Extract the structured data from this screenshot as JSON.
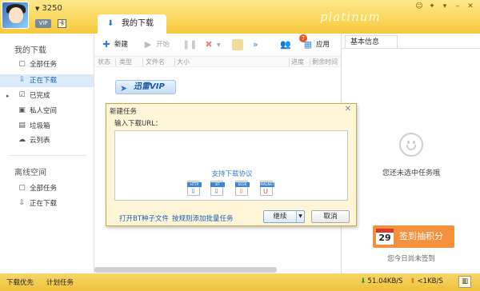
{
  "user": {
    "name": "3250",
    "vip_label": "VIP"
  },
  "brand": "platinum",
  "sidebar": {
    "section1_title": "我的下载",
    "items": [
      {
        "label": "全部任务",
        "icon": "doc-icon"
      },
      {
        "label": "正在下载",
        "icon": "download-arrow-icon",
        "active": true
      },
      {
        "label": "已完成",
        "icon": "check-icon"
      },
      {
        "label": "私人空间",
        "icon": "lock-icon"
      },
      {
        "label": "垃圾箱",
        "icon": "trash-icon"
      },
      {
        "label": "云列表",
        "icon": "cloud-icon"
      }
    ],
    "section2_title": "离线空间",
    "offline_items": [
      {
        "label": "全部任务",
        "icon": "doc-icon"
      },
      {
        "label": "正在下载",
        "icon": "download-arrow-icon"
      }
    ]
  },
  "main": {
    "tab_label": "我的下载",
    "toolbar": {
      "new": "新建",
      "start": "开始",
      "more": "»",
      "app": "应用",
      "app_badge": "7"
    },
    "columns": [
      "状态",
      "类型",
      "文件名",
      "大小",
      "进度",
      "剩余时间"
    ],
    "vip_button": "迅雷VIP"
  },
  "dialog": {
    "title": "新建任务",
    "url_label": "输入下载URL：",
    "hint": "支持下载协议",
    "protocols": [
      "HTTP",
      "BT",
      "ED2K",
      "MAGNET"
    ],
    "link_bt": "打开BT种子文件",
    "link_batch": "按规则添加批量任务",
    "continue": "继续",
    "cancel": "取消"
  },
  "right_panel": {
    "tab": "基本信息",
    "empty_text": "您还未选中任务哦",
    "signin_day": "29",
    "signin_label": "签到抽积分",
    "signin_sub": "您今日尚未签到"
  },
  "statusbar": {
    "left1": "下载优先",
    "left2": "计划任务",
    "down_speed": "51.04KB/S",
    "up_speed": "<1KB/S"
  },
  "colors": {
    "accent_yellow": "#f4d35a",
    "active_blue": "#dcebfb",
    "signin_orange": "#f3913c"
  }
}
